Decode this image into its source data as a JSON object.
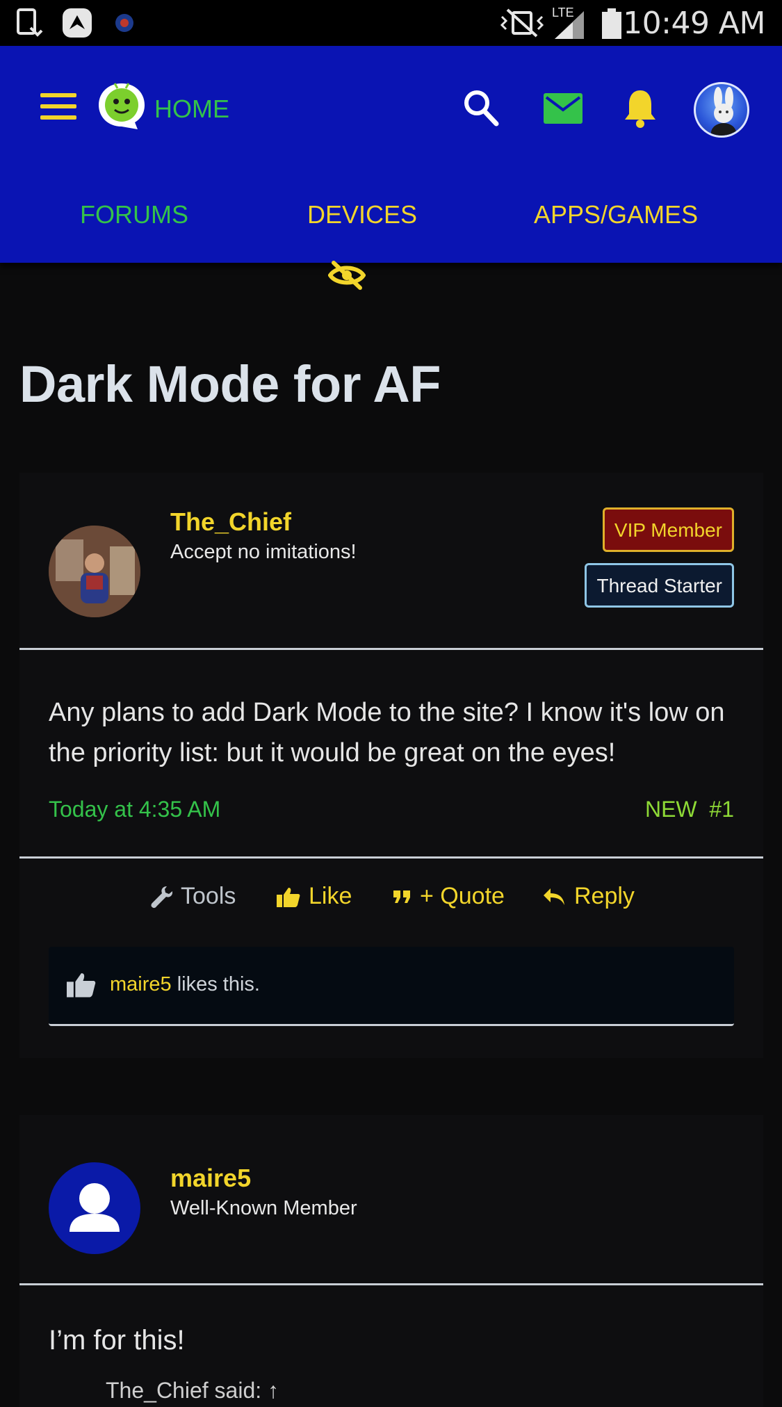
{
  "status_bar": {
    "time": "10:49 AM",
    "network": "LTE"
  },
  "header": {
    "home_label": "HOME",
    "tabs": [
      {
        "label": "FORUMS",
        "color": "#34c24a"
      },
      {
        "label": "DEVICES",
        "color": "#f2d52b"
      },
      {
        "label": "APPS/GAMES",
        "color": "#f2d52b"
      }
    ],
    "colors": {
      "background": "#0a14b3",
      "accent_yellow": "#f2d52b",
      "accent_green": "#34c24a"
    }
  },
  "page": {
    "title": "Dark Mode for AF"
  },
  "posts": [
    {
      "username": "The_Chief",
      "user_title": "Accept no imitations!",
      "badges": [
        "VIP Member",
        "Thread Starter"
      ],
      "text": "Any plans to add Dark Mode to the site? I know it's low on the priority list: but it would be great on the eyes!",
      "date": "Today at 4:35 AM",
      "new_label": "NEW",
      "number": "#1",
      "actions": {
        "tools": "Tools",
        "like": "Like",
        "quote": "+ Quote",
        "reply": "Reply"
      },
      "likes": {
        "name": "maire5",
        "suffix": " likes this."
      }
    },
    {
      "username": "maire5",
      "user_title": "Well-Known Member",
      "text": "I’m for this!",
      "quote_attribution": "The_Chief said: ↑"
    }
  ]
}
